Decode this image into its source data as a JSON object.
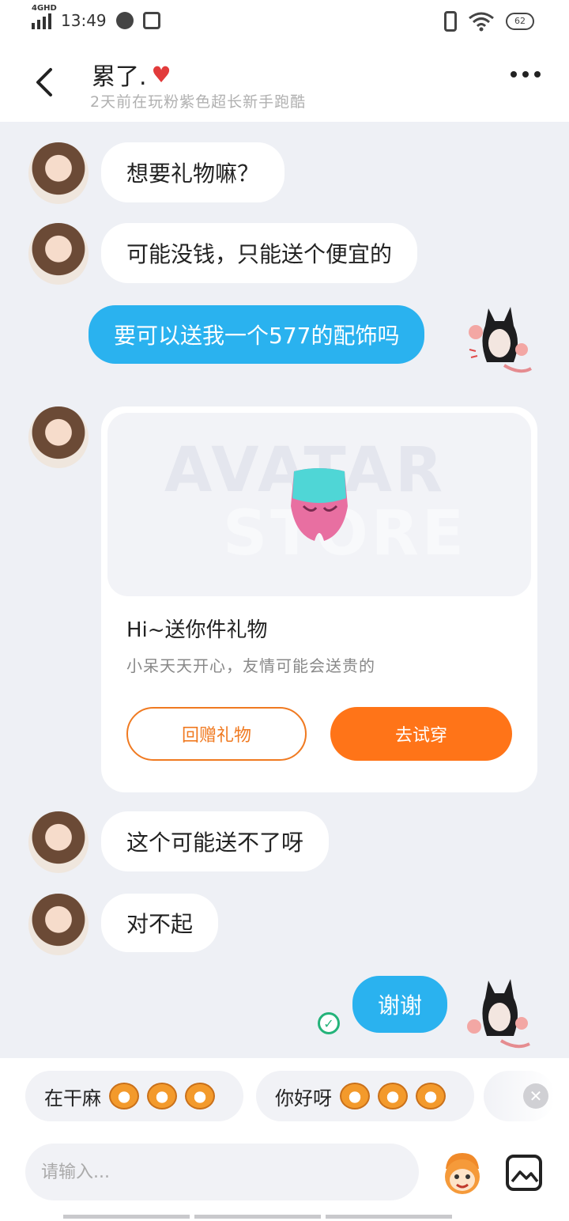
{
  "status_bar": {
    "network": "4GHD",
    "time": "13:49",
    "battery": "62"
  },
  "header": {
    "name": "累了.",
    "subtitle": "2天前在玩粉紫色超长新手跑酷"
  },
  "messages": [
    {
      "side": "in",
      "text": "想要礼物嘛？"
    },
    {
      "side": "in",
      "text": "可能没钱，只能送个便宜的"
    },
    {
      "side": "out",
      "text": "要可以送我一个577的配饰吗"
    },
    {
      "side": "in",
      "text": "这个可能送不了呀"
    },
    {
      "side": "in",
      "text": "对不起"
    },
    {
      "side": "out",
      "text": "谢谢"
    }
  ],
  "gift_card": {
    "watermark_line1": "AVATAR",
    "watermark_line2": "STORE",
    "title": "Hi~送你件礼物",
    "subtitle": "小呆天天开心，友情可能会送贵的",
    "return_gift_label": "回赠礼物",
    "try_on_label": "去试穿"
  },
  "quick_replies": [
    {
      "text": "在干麻"
    },
    {
      "text": "你好呀"
    }
  ],
  "input": {
    "placeholder": "请输入..."
  },
  "colors": {
    "accent_blue": "#2ab2ef",
    "accent_orange": "#ff7418",
    "background": "#eef0f5",
    "sent_check": "#24b37a"
  }
}
